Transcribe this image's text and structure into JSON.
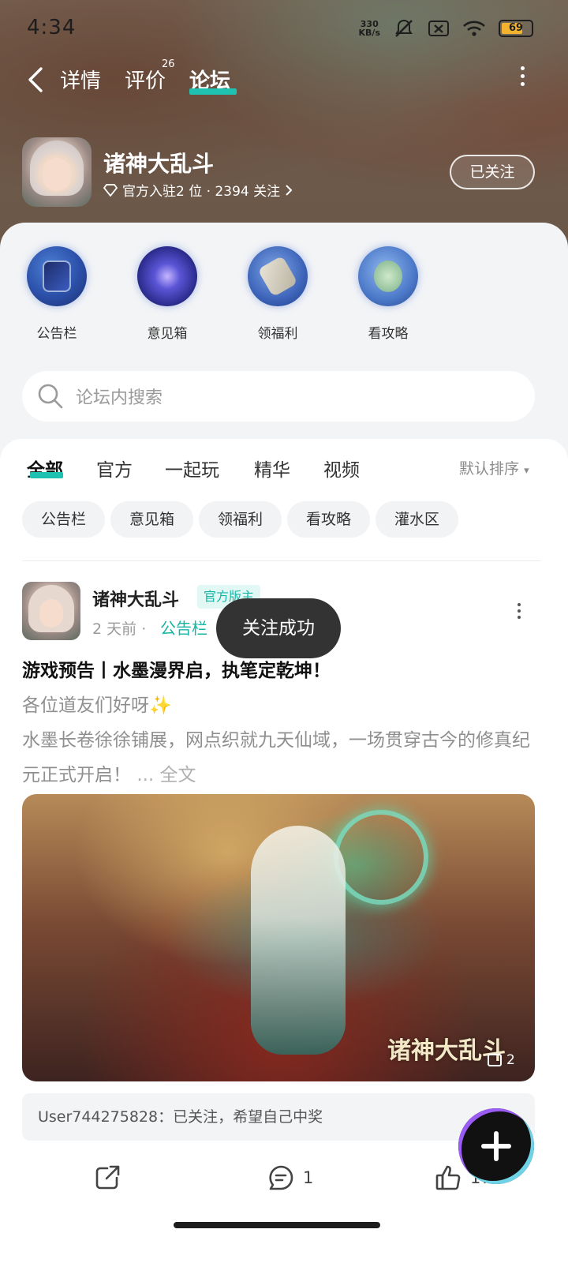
{
  "status_bar": {
    "time": "4:34",
    "network_speed_value": "330",
    "network_speed_unit": "KB/s",
    "battery": "69"
  },
  "top_nav": {
    "tabs": [
      {
        "label": "详情"
      },
      {
        "label": "评价",
        "count": "26"
      },
      {
        "label": "论坛"
      }
    ],
    "active_tab": "论坛"
  },
  "game": {
    "title": "诸神大乱斗",
    "meta": "官方入驻2 位 · 2394 关注",
    "follow_label": "已关注"
  },
  "categories": [
    {
      "label": "公告栏",
      "icon": "bulletin-scroll-icon"
    },
    {
      "label": "意见箱",
      "icon": "galaxy-icon"
    },
    {
      "label": "领福利",
      "icon": "gift-scroll-icon"
    },
    {
      "label": "看攻略",
      "icon": "cabbage-icon"
    }
  ],
  "search": {
    "placeholder": "论坛内搜索"
  },
  "feed_tabs": [
    {
      "label": "全部"
    },
    {
      "label": "官方"
    },
    {
      "label": "一起玩"
    },
    {
      "label": "精华"
    },
    {
      "label": "视频"
    }
  ],
  "sort_label": "默认排序",
  "chips": [
    "公告栏",
    "意见箱",
    "领福利",
    "看攻略",
    "灌水区"
  ],
  "post": {
    "author": "诸神大乱斗",
    "badge": "官方版主",
    "time": "2 天前",
    "separator": "·",
    "section": "公告栏",
    "title": "游戏预告丨水墨漫界启，执笔定乾坤！",
    "body_line1": "各位道友们好呀✨",
    "body_line2": "水墨长卷徐徐铺展，网点织就九天仙域，一场贯穿古今的修真纪元正式开启！",
    "more": "... 全文",
    "image_watermark": "诸神大乱斗",
    "image_count": "2",
    "comment_preview": "User744275828：已关注，希望自己中奖",
    "comments": "1",
    "likes": "17"
  },
  "toast": "关注成功",
  "colors": {
    "accent": "#1fc1b0",
    "toast_bg": "#333333"
  }
}
